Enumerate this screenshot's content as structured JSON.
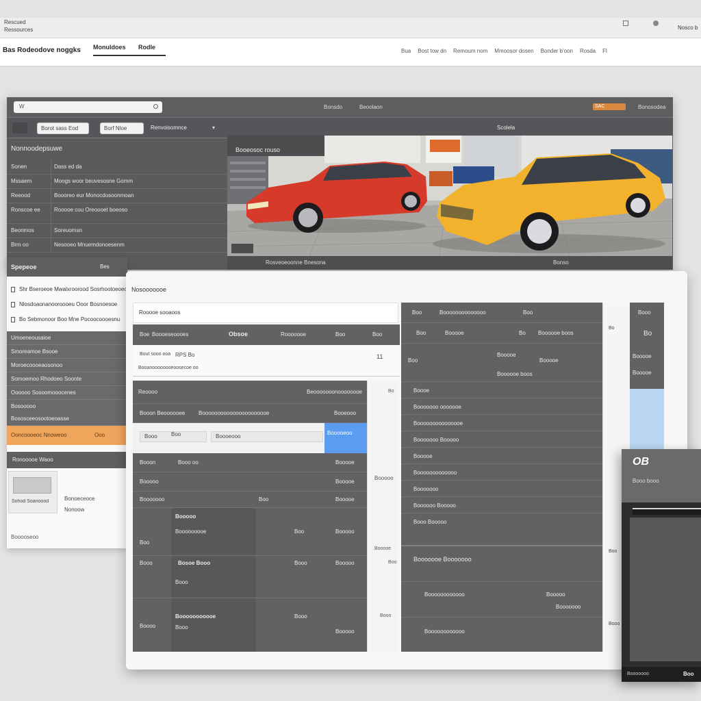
{
  "topbar": {
    "app_name": "Rescued",
    "menu_label": "Ressources",
    "right_text": "Nosco b",
    "icons": [
      "grid-icon",
      "user-icon"
    ]
  },
  "topnav": {
    "brand": "Bas Rodeodove noggks",
    "active_tab": "Monuldoes",
    "active_tab_sub": "Rodle",
    "links": [
      "Bua",
      "Bost tow dn",
      "Remoum nom",
      "Mmoosor dosen",
      "Bonder b'oon",
      "Rosda",
      "Fl"
    ]
  },
  "back_window": {
    "search_placeholder": "W",
    "toolbar_labels": [
      "Bonsdo",
      "Beoolaon"
    ],
    "toolbar_badge": "SAC",
    "toolbar_right": "Bonosodea",
    "tab_buttons": [
      "Borot sass Eod",
      "Borf Nloe"
    ],
    "tab_text": "Renvoisomnce",
    "photo_header": "Scolela",
    "table_title": "Nonnoodepsuwe",
    "photo_title": "Booeosoc rouso",
    "rows": [
      {
        "c1": "Sonen",
        "c2": "Dass ed da"
      },
      {
        "c1": "Mssaem",
        "c2": "Moogs woor beuvesosne Gomm"
      },
      {
        "c1": "Reeood",
        "c2": "Boooreo eur Monocdosoonmoan"
      },
      {
        "c1": "Ronscoe ee",
        "c2": "Rooooe cou Oreoooet boeoso"
      },
      {
        "c1": "Beonmos",
        "c2": "Soreuomsn"
      },
      {
        "c1": "Brm oo",
        "c2": "Nesooeo Mnuemdonoesenm"
      }
    ],
    "caption": "Rosveoeoonne Bnesona",
    "caption_right": "Bonso"
  },
  "left_panel": {
    "header": "Spepeoe",
    "header_badge": "Bes",
    "items": [
      "Shr Bseroeoe Mwalxroorood Sosrhootoeoeoe",
      "Nlosdoaonanooroooeu Ooor Bosnoesoe",
      "Bo Sebmonoor Boo Mne Pocoocoooesnu"
    ],
    "dark_items": [
      "Umoeneousaioe",
      "Smoreamoe Bsooe",
      "Moroecoooeaosonoo",
      "Somoemoo Rhodoeo Soonte",
      "Oooooo Sosoomooocenes",
      "Bosooooo",
      "Bososceeosootoeoasse"
    ],
    "highlight_item": "Ooncoooeoc Nnoweoo",
    "highlight_badge": "Ooo",
    "footer_head": "Ronooooe Waoo",
    "thumb_caption": "Sohod Soanoood",
    "side_text": [
      "Bonoeceoce",
      "Nonoow"
    ],
    "footer_note": "Booooseoo"
  },
  "main_window": {
    "title": "Nosooooooe",
    "subtitle": "Rooooe sooaoos",
    "header_cells": [
      "Boe",
      "Boooeseoooes",
      "Obsoe",
      "Rooooooe",
      "Boo",
      "Boo"
    ],
    "detail_lines": [
      "Bout sooo ooa",
      "RPS Bo",
      "Booanoooooooeoosecoe oo",
      "11"
    ],
    "table_head": [
      "Reoooo",
      "Beooooooonoooooooe"
    ],
    "sub_row": [
      "Booon Beoooooee",
      "Boooooooooooooooooooooe",
      "Booeooo"
    ],
    "selected_row": [
      "Booo",
      "Boo",
      "Boooeooo",
      "Booooeoo"
    ],
    "data_rows": [
      {
        "a": "Booon",
        "b": "Booo oo",
        "c": "Booooe"
      },
      {
        "a": "Booooo",
        "b": "",
        "c": "Booooe"
      },
      {
        "a": "Booooooo",
        "b": "Boo",
        "c": "Booooe"
      }
    ],
    "group_rows": [
      {
        "label": "Boo",
        "title": "Booooo",
        "sub": "Booooooooe",
        "v1": "Boo",
        "v2": "Booooo"
      },
      {
        "label": "Booo",
        "title": "Bosoe Booo",
        "sub": "Booo",
        "v1": "Booo",
        "v2": "Booooo"
      },
      {
        "label": "Boooo",
        "title": "Booooooooooe",
        "sub": "Booo",
        "v1": "Booo",
        "v2": "Booooo"
      }
    ],
    "right_head": [
      "Boo",
      "Boooooooooooooo",
      "Boo",
      "Booo"
    ],
    "right_sub": [
      "Boo",
      "Booooe",
      "Bo",
      "Boooooe boos",
      "Boo"
    ],
    "right_list": [
      "Boooe",
      "Booooooo ooooooe",
      "Booooooooooooooe",
      "Booooooo Booooo",
      "Booooe",
      "Booooooooooooo",
      "Booooooo",
      "Boooooo Booooo",
      "Booo Booooo"
    ],
    "right_section": "Booooooe Booooooo",
    "right_footer": [
      "Boooooooooooo",
      "Booooo",
      "Booooooo"
    ],
    "side_values": [
      "Bo",
      "Booooo",
      "Booooe",
      "Boo",
      "Booo"
    ]
  },
  "float_card": {
    "title": "OB",
    "line": "Booo booo",
    "footer": "Booooooo",
    "footer_right": "Boo"
  },
  "colors": {
    "selection_blue": "#5b9cf0",
    "highlight_orange": "#f0a55c",
    "light_blue": "#b9d6f2",
    "red_car": "#d63a2a",
    "yellow_car": "#f2b22e"
  }
}
